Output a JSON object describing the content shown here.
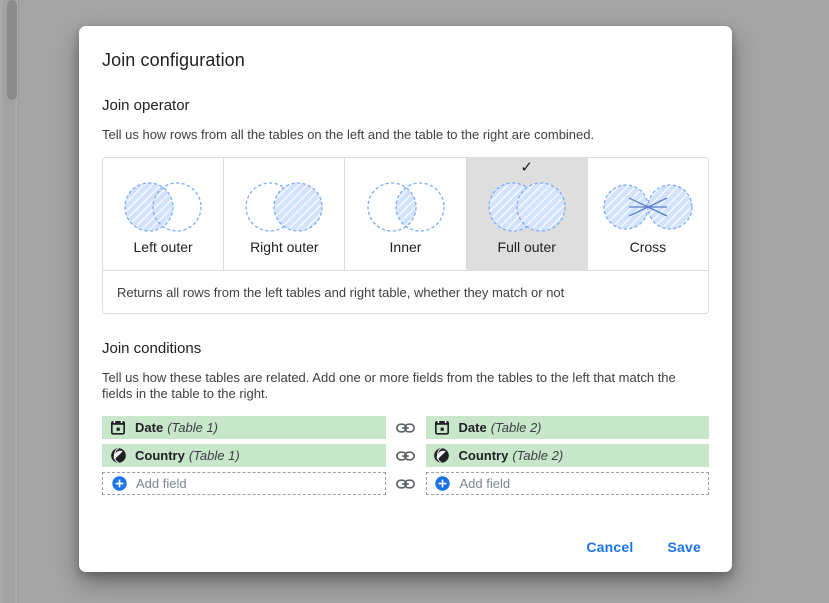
{
  "dialog": {
    "title": "Join configuration",
    "operator_section_title": "Join operator",
    "operator_helper": "Tell us how rows from all the tables on the left and the table to the right are combined.",
    "operator_description": "Returns all rows from the left tables and right table, whether they match or not",
    "conditions_section_title": "Join conditions",
    "conditions_helper": "Tell us how these tables are related. Add one or more fields from the tables to the left that match the fields in the table to the right.",
    "cancel_label": "Cancel",
    "save_label": "Save"
  },
  "operators": [
    {
      "label": "Left outer",
      "venn": "left-outer",
      "selected": false,
      "check": ""
    },
    {
      "label": "Right outer",
      "venn": "right-outer",
      "selected": false,
      "check": ""
    },
    {
      "label": "Inner",
      "venn": "inner",
      "selected": false,
      "check": ""
    },
    {
      "label": "Full outer",
      "venn": "full-outer",
      "selected": true,
      "check": "✓"
    },
    {
      "label": "Cross",
      "venn": "cross",
      "selected": false,
      "check": ""
    }
  ],
  "conditions": [
    {
      "left": {
        "name": "Date",
        "table": "(Table 1)",
        "icon": "calendar-icon",
        "placeholder": false
      },
      "right": {
        "name": "Date",
        "table": "(Table 2)",
        "icon": "calendar-icon",
        "placeholder": false
      },
      "link_icon": "link-icon"
    },
    {
      "left": {
        "name": "Country",
        "table": "(Table 1)",
        "icon": "globe-icon",
        "placeholder": false
      },
      "right": {
        "name": "Country",
        "table": "(Table 2)",
        "icon": "globe-icon",
        "placeholder": false
      },
      "link_icon": "link-icon"
    },
    {
      "left": {
        "name": "Add field",
        "table": "",
        "icon": "add-circle-icon",
        "placeholder": true
      },
      "right": {
        "name": "Add field",
        "table": "",
        "icon": "add-circle-icon",
        "placeholder": true
      },
      "link_icon": "link-icon"
    }
  ],
  "colors": {
    "accent_blue": "#1a73e8",
    "chip_green": "#c8e6c9",
    "venn_stroke": "#7baaf7",
    "venn_fill": "#d3e3fd",
    "selected_card_bg": "#dedede",
    "scrim": "#a5a5a5"
  }
}
